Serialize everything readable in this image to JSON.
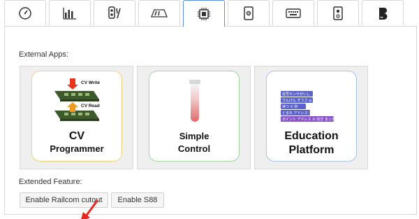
{
  "tabs": [
    {
      "icon": "speedometer-icon",
      "active": false
    },
    {
      "icon": "bar-chart-icon",
      "active": false
    },
    {
      "icon": "traffic-signal-icon",
      "active": false
    },
    {
      "icon": "track-layout-icon",
      "active": false
    },
    {
      "icon": "chip-icon",
      "active": true
    },
    {
      "icon": "phone-settings-icon",
      "active": false
    },
    {
      "icon": "keyboard-icon",
      "active": false
    },
    {
      "icon": "speaker-icon",
      "active": false
    },
    {
      "icon": "scratch-logo-icon",
      "active": false
    }
  ],
  "panel": {
    "external_apps_label": "External Apps:",
    "apps": [
      {
        "title_line1": "CV",
        "title_line2": "Programmer",
        "icon_label_top": "CV Write",
        "icon_label_bottom": "CV Read",
        "border_color": "#f1d27a"
      },
      {
        "title_line1": "Simple",
        "title_line2": "Control",
        "border_color": "#a5d3a0"
      },
      {
        "title_line1": "Education",
        "title_line2": "Platform",
        "blocks": [
          "信号センサがいし",
          "でんげん そうさ ◎",
          "待つ ① 秒",
          "とまれ アドレス ③",
          "ポイント アドレス ③ 向き まっすぐ"
        ],
        "border_color": "#a8c3e8"
      }
    ],
    "extended_feature_label": "Extended Feature:",
    "buttons": {
      "railcom": "Enable Railcom cutout",
      "s88": "Enable S88"
    }
  },
  "colors": {
    "accent_tab": "#5a8fd6",
    "arrow": "#e8261f"
  }
}
